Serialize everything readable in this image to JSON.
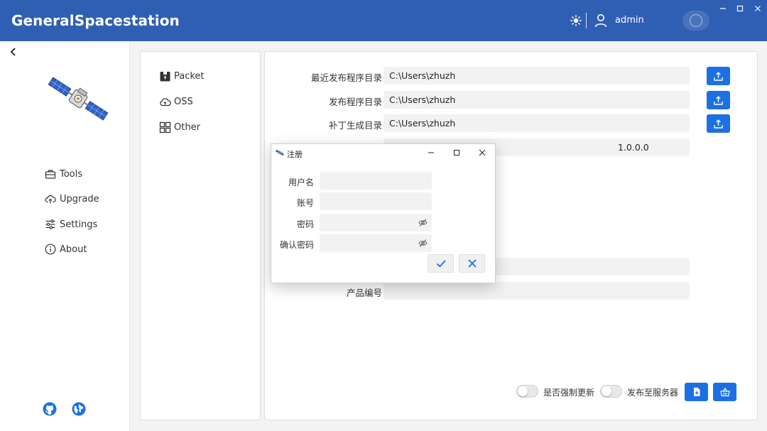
{
  "app": {
    "title": "GeneralSpacestation"
  },
  "header": {
    "username": "admin"
  },
  "icons": {
    "theme": "sun-icon",
    "user": "user-icon",
    "avatar": "avatar-icon",
    "minimize": "minimize-icon",
    "maximize": "maximize-icon",
    "close": "close-icon"
  },
  "leftnav": {
    "items": [
      {
        "label": "Tools",
        "icon": "toolbox-icon"
      },
      {
        "label": "Upgrade",
        "icon": "cloud-upload-icon"
      },
      {
        "label": "Settings",
        "icon": "sliders-icon"
      },
      {
        "label": "About",
        "icon": "info-icon"
      }
    ],
    "bottom_icons": [
      "github-icon",
      "globe-icon"
    ]
  },
  "midnav": {
    "items": [
      {
        "label": "Packet",
        "icon": "package-icon"
      },
      {
        "label": "OSS",
        "icon": "cloud-icon"
      },
      {
        "label": "Other",
        "icon": "grid-icon"
      }
    ]
  },
  "form": {
    "fields": [
      {
        "label": "最近发布程序目录",
        "value": "C:\\Users\\zhuzh"
      },
      {
        "label": "发布程序目录",
        "value": "C:\\Users\\zhuzh"
      },
      {
        "label": "补丁生成目录",
        "value": "C:\\Users\\zhuzh"
      },
      {
        "label": "",
        "value": "1.0.0.0"
      },
      {
        "label": "产品编号",
        "value": ""
      }
    ],
    "toggles": [
      {
        "label": "是否强制更新",
        "on": false
      },
      {
        "label": "发布至服务器",
        "on": false
      }
    ]
  },
  "dialog": {
    "title": "注册",
    "fields": [
      {
        "label": "用户名",
        "value": ""
      },
      {
        "label": "账号",
        "value": ""
      },
      {
        "label": "密码",
        "value": ""
      },
      {
        "label": "确认密码",
        "value": ""
      }
    ],
    "confirm_icon": "check-icon",
    "cancel_icon": "x-icon"
  },
  "colors": {
    "header": "#2f5fb3",
    "accent": "#1c70e3"
  }
}
